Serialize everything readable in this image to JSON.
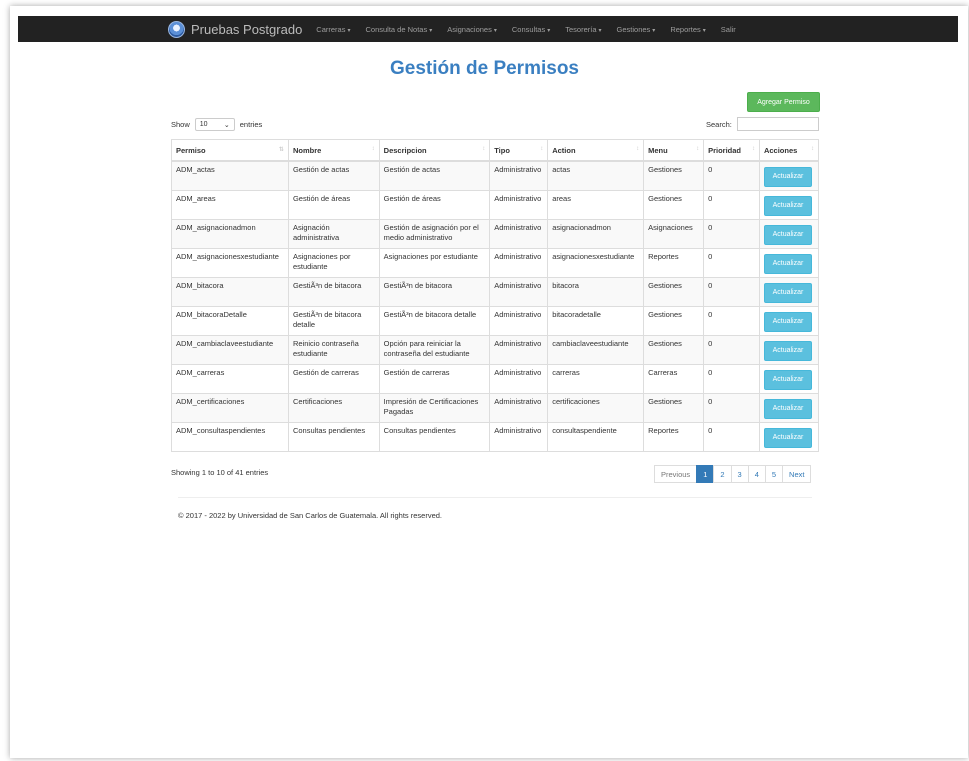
{
  "navbar": {
    "brand": "Pruebas Postgrado",
    "items": [
      {
        "label": "Carreras",
        "has_caret": true
      },
      {
        "label": "Consulta de Notas",
        "has_caret": true
      },
      {
        "label": "Asignaciones",
        "has_caret": true
      },
      {
        "label": "Consultas",
        "has_caret": true
      },
      {
        "label": "Tesorería",
        "has_caret": true
      },
      {
        "label": "Gestiones",
        "has_caret": true
      },
      {
        "label": "Reportes",
        "has_caret": true
      },
      {
        "label": "Salir",
        "has_caret": false
      }
    ]
  },
  "page": {
    "title": "Gestión de Permisos",
    "add_button": "Agregar Permiso"
  },
  "controls": {
    "show_label": "Show",
    "entries_value": "10",
    "entries_label": "entries",
    "search_label": "Search:"
  },
  "table": {
    "headers": [
      "Permiso",
      "Nombre",
      "Descripcion",
      "Tipo",
      "Action",
      "Menu",
      "Prioridad",
      "Acciones"
    ],
    "action_label": "Actualizar",
    "rows": [
      [
        "ADM_actas",
        "Gestión de actas",
        "Gestión de actas",
        "Administrativo",
        "actas",
        "Gestiones",
        "0"
      ],
      [
        "ADM_areas",
        "Gestión de áreas",
        "Gestión de áreas",
        "Administrativo",
        "areas",
        "Gestiones",
        "0"
      ],
      [
        "ADM_asignacionadmon",
        "Asignación administrativa",
        "Gestión de asignación por el medio administrativo",
        "Administrativo",
        "asignacionadmon",
        "Asignaciones",
        "0"
      ],
      [
        "ADM_asignacionesxestudiante",
        "Asignaciones por estudiante",
        "Asignaciones por estudiante",
        "Administrativo",
        "asignacionesxestudiante",
        "Reportes",
        "0"
      ],
      [
        "ADM_bitacora",
        "GestiÃ³n de bitacora",
        "GestiÃ³n de bitacora",
        "Administrativo",
        "bitacora",
        "Gestiones",
        "0"
      ],
      [
        "ADM_bitacoraDetalle",
        "GestiÃ³n de bitacora detalle",
        "GestiÃ³n de bitacora detalle",
        "Administrativo",
        "bitacoradetalle",
        "Gestiones",
        "0"
      ],
      [
        "ADM_cambiaclaveestudiante",
        "Reinicio contraseña estudiante",
        "Opción para reiniciar la contraseña del estudiante",
        "Administrativo",
        "cambiaclaveestudiante",
        "Gestiones",
        "0"
      ],
      [
        "ADM_carreras",
        "Gestión de carreras",
        "Gestión de carreras",
        "Administrativo",
        "carreras",
        "Carreras",
        "0"
      ],
      [
        "ADM_certificaciones",
        "Certificaciones",
        "Impresión de Certificaciones Pagadas",
        "Administrativo",
        "certificaciones",
        "Gestiones",
        "0"
      ],
      [
        "ADM_consultaspendientes",
        "Consultas pendientes",
        "Consultas pendientes",
        "Administrativo",
        "consultaspendiente",
        "Reportes",
        "0"
      ]
    ]
  },
  "pagination": {
    "info": "Showing 1 to 10 of 41 entries",
    "previous": "Previous",
    "pages": [
      "1",
      "2",
      "3",
      "4",
      "5"
    ],
    "active_page": "1",
    "next": "Next"
  },
  "footer": {
    "text": "© 2017 - 2022 by Universidad de San Carlos de Guatemala. All rights reserved."
  },
  "colors": {
    "navbar": "#222222",
    "title": "#3a7fc1",
    "add_button": "#5cb85c",
    "update_button": "#5bc0de",
    "active_page": "#337ab7"
  }
}
